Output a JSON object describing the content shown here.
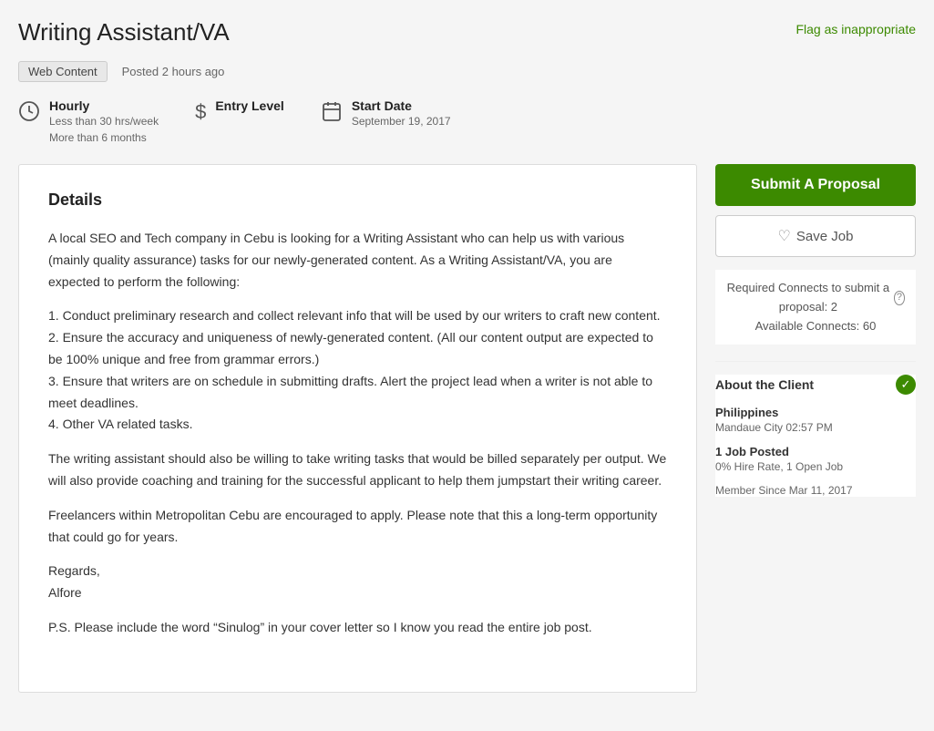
{
  "page": {
    "title": "Writing Assistant/VA",
    "flag_label": "Flag as inappropriate"
  },
  "meta": {
    "badge": "Web Content",
    "posted": "Posted 2 hours ago"
  },
  "job_details": [
    {
      "id": "hourly",
      "icon": "clock",
      "label": "Hourly",
      "sub1": "Less than 30 hrs/week",
      "sub2": "More than 6 months"
    },
    {
      "id": "level",
      "icon": "dollar",
      "label": "Entry Level",
      "sub1": "",
      "sub2": ""
    },
    {
      "id": "start",
      "icon": "calendar",
      "label": "Start Date",
      "sub1": "September 19, 2017",
      "sub2": ""
    }
  ],
  "details": {
    "heading": "Details",
    "paragraphs": [
      "A local SEO and Tech company in Cebu is looking for a Writing Assistant who can help us with various (mainly quality assurance) tasks for our newly-generated content. As a Writing Assistant/VA, you are expected to perform the following:",
      "1. Conduct preliminary research and collect relevant info that will be used by our writers to craft new content.\n2. Ensure the accuracy and uniqueness of newly-generated content. (All our content output are expected to be 100% unique and free from grammar errors.)\n3. Ensure that writers are on schedule in submitting drafts. Alert the project lead when a writer is not able to meet deadlines.\n4. Other VA related tasks.",
      "The writing assistant should also be willing to take writing tasks that would be billed separately per output. We will also provide coaching and training for the successful applicant to help them jumpstart their writing career.",
      "Freelancers within Metropolitan Cebu are encouraged to apply. Please note that this a long-term opportunity that could go for years.",
      "Regards,\nAlfore",
      "P.S. Please include the word “Sinulog” in your cover letter so I know you read the entire job post."
    ]
  },
  "sidebar": {
    "submit_label": "Submit A Proposal",
    "save_label": "Save Job",
    "connects_text": "Required Connects to submit a proposal: 2",
    "available_connects": "Available Connects: 60",
    "about_client_title": "About the Client",
    "client_country": "Philippines",
    "client_city": "Mandaue City 02:57 PM",
    "jobs_posted_label": "1 Job Posted",
    "jobs_posted_sub": "0% Hire Rate, 1 Open Job",
    "member_since": "Member Since Mar 11, 2017"
  }
}
